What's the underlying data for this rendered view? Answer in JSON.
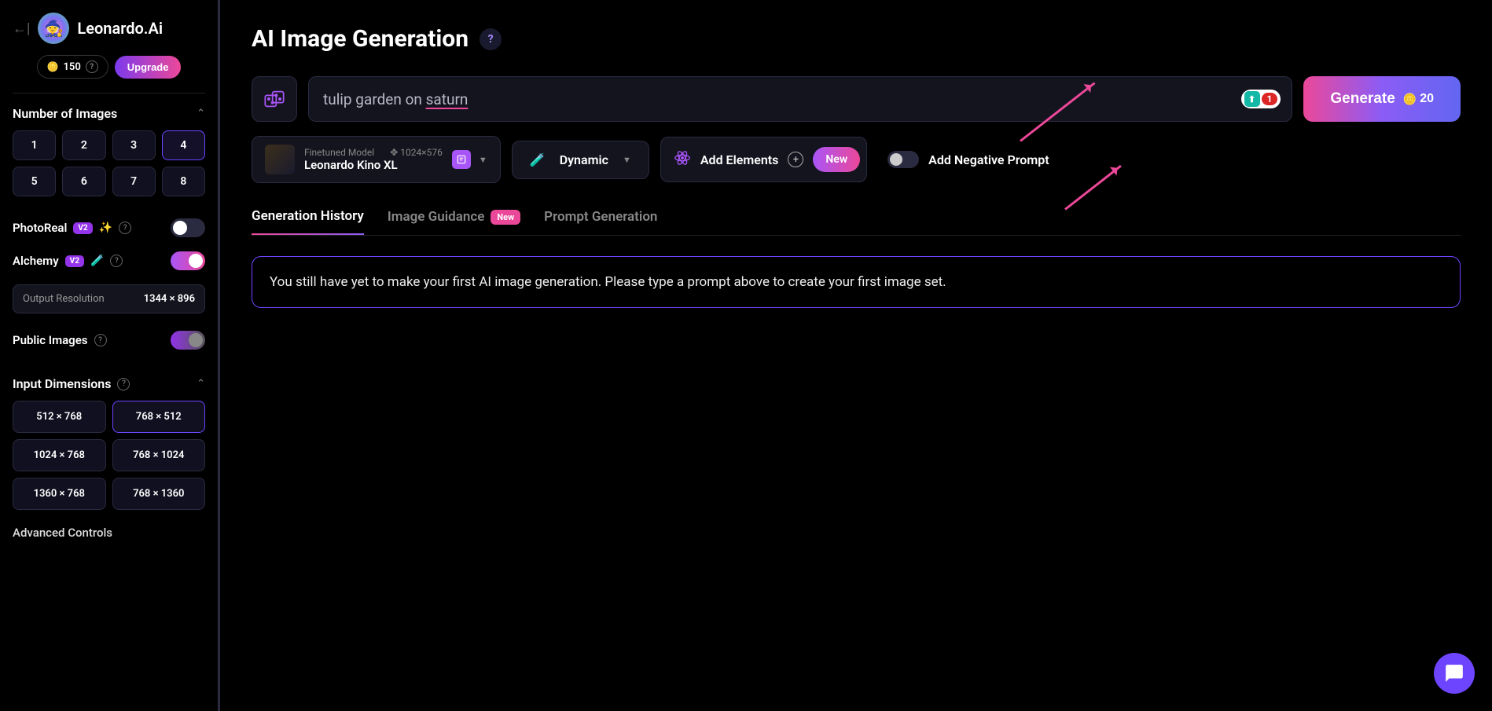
{
  "brand": {
    "name": "Leonardo.Ai"
  },
  "credits": {
    "amount": "150",
    "upgrade": "Upgrade"
  },
  "sidebar": {
    "num_images_title": "Number of Images",
    "num_options": [
      "1",
      "2",
      "3",
      "4",
      "5",
      "6",
      "7",
      "8"
    ],
    "num_selected": "4",
    "photoreal": {
      "label": "PhotoReal",
      "badge": "V2"
    },
    "alchemy": {
      "label": "Alchemy",
      "badge": "V2"
    },
    "output_res": {
      "label": "Output Resolution",
      "value": "1344 × 896"
    },
    "public_images": {
      "label": "Public Images"
    },
    "input_dims_title": "Input Dimensions",
    "dims": [
      "512 × 768",
      "768 × 512",
      "1024 × 768",
      "768 × 1024",
      "1360 × 768",
      "768 × 1360"
    ],
    "dims_selected": "768 × 512",
    "advanced": "Advanced Controls"
  },
  "main": {
    "title": "AI Image Generation",
    "prompt_prefix": "tulip garden on ",
    "prompt_underlined": "saturn",
    "prompt_badge_count": "1",
    "generate": "Generate",
    "generate_count": "20",
    "model": {
      "type": "Finetuned Model",
      "name": "Leonardo Kino XL",
      "dims": "1024×576"
    },
    "dynamic": "Dynamic",
    "elements": {
      "label": "Add Elements",
      "badge": "New"
    },
    "neg_prompt": "Add Negative Prompt",
    "tabs": {
      "history": "Generation History",
      "guidance": "Image Guidance",
      "guidance_badge": "New",
      "prompt_gen": "Prompt Generation"
    },
    "empty": "You still have yet to make your first AI image generation. Please type a prompt above to create your first image set."
  }
}
